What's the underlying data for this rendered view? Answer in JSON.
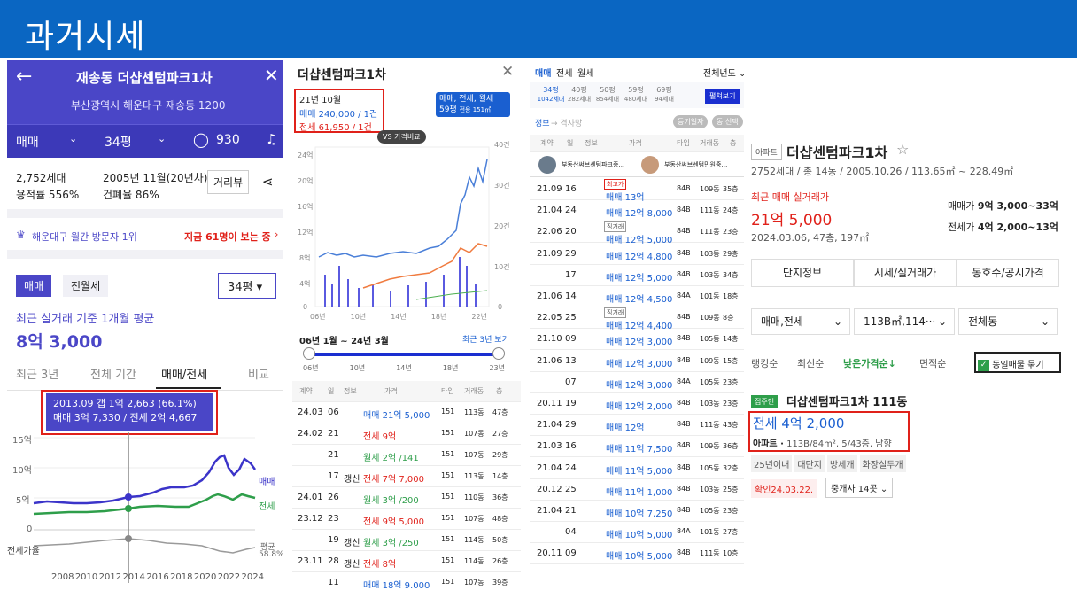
{
  "slide": {
    "title": "과거시세"
  },
  "p1": {
    "title": "재송동 더샵센텀파크1차",
    "address": "부산광역시 해운대구 재송동 1200",
    "tab_trade": "매매",
    "tab_size": "34평",
    "comment_count": "930",
    "households": "2,752세대",
    "built": "2005년 11월(20년차)",
    "far": "용적률 556%",
    "bcr": "건폐율 86%",
    "street_view": "거리뷰",
    "rank": "해운대구 월간 방문자 1위",
    "viewing": "지금 61명이 보는 중",
    "btn_trade": "매매",
    "btn_rent": "전월세",
    "size_select": "34평",
    "avg_label": "최근 실거래 기준 1개월 평균",
    "avg_price": "8억 3,000",
    "tabs": [
      "최근 3년",
      "전체 기간",
      "매매/전세",
      "비교"
    ],
    "tip1": "2013.09 갭 1억 2,663 (66.1%)",
    "tip2": "매매 3억 7,330 / 전세 2억 4,667",
    "y_labels": [
      "15억",
      "10억",
      "5억",
      "0"
    ],
    "legend_sale": "매매",
    "legend_rent": "전세",
    "ratio_label": "전세가율",
    "avg_text": "평균",
    "avg_ratio": "58.8%",
    "x_labels": [
      "2008",
      "2010",
      "2012",
      "2014",
      "2016",
      "2018",
      "2020",
      "2022",
      "2024"
    ]
  },
  "p2": {
    "title": "더샵센텀파크1차",
    "month": "21년 10월",
    "sale": "매매 240,000 / 1건",
    "rent": "전세 61,950 / 1건",
    "filter1": "매매, 전세, 월세",
    "filter2": "59평",
    "filter3": "전용 151㎡",
    "vs_label": "VS 가격비교",
    "y_left": [
      "24억",
      "20억",
      "16억",
      "12억",
      "8억",
      "4억",
      "0"
    ],
    "y_right": [
      "40건",
      "30건",
      "20건",
      "10건",
      "0"
    ],
    "x_labels": [
      "06년",
      "10년",
      "14년",
      "18년",
      "22년"
    ],
    "range": "06년 1월 ~ 24년 3월",
    "recent": "최근 3년 보기",
    "slider_ticks": [
      "06년",
      "10년",
      "14년",
      "18년",
      "23년"
    ],
    "headers": [
      "계약",
      "일",
      "정보",
      "가격",
      "타입",
      "거래동",
      "층"
    ],
    "rows": [
      {
        "m": "24.03",
        "d": "06",
        "info": "",
        "price": "매매 21억 5,000",
        "type": "151",
        "dong": "113동",
        "floor": "47층",
        "kind": "sale"
      },
      {
        "m": "24.02",
        "d": "21",
        "info": "",
        "price": "전세 9억",
        "type": "151",
        "dong": "107동",
        "floor": "27층",
        "kind": "rent"
      },
      {
        "m": "",
        "d": "21",
        "info": "",
        "price": "월세 2억 /141",
        "type": "151",
        "dong": "107동",
        "floor": "29층",
        "kind": "month"
      },
      {
        "m": "",
        "d": "17",
        "info": "갱신",
        "price": "전세 7억 7,000",
        "type": "151",
        "dong": "113동",
        "floor": "14층",
        "kind": "rent"
      },
      {
        "m": "24.01",
        "d": "26",
        "info": "",
        "price": "월세 3억 /200",
        "type": "151",
        "dong": "110동",
        "floor": "36층",
        "kind": "month"
      },
      {
        "m": "23.12",
        "d": "23",
        "info": "",
        "price": "전세 9억 5,000",
        "type": "151",
        "dong": "107동",
        "floor": "48층",
        "kind": "rent"
      },
      {
        "m": "",
        "d": "19",
        "info": "갱신",
        "price": "월세 3억 /250",
        "type": "151",
        "dong": "114동",
        "floor": "50층",
        "kind": "month"
      },
      {
        "m": "23.11",
        "d": "28",
        "info": "갱신",
        "price": "전세 8억",
        "type": "151",
        "dong": "114동",
        "floor": "26층",
        "kind": "rent"
      },
      {
        "m": "",
        "d": "11",
        "info": "",
        "price": "매매 18억 9,000",
        "type": "151",
        "dong": "107동",
        "floor": "39층",
        "kind": "sale"
      }
    ]
  },
  "p3": {
    "tabs": [
      "매매",
      "전세",
      "월세"
    ],
    "year": "전체년도",
    "sizes": [
      {
        "a": "34평",
        "b": "1042세대"
      },
      {
        "a": "40평",
        "b": "282세대"
      },
      {
        "a": "50평",
        "b": "854세대"
      },
      {
        "a": "59평",
        "b": "480세대"
      },
      {
        "a": "69평",
        "b": "94세대"
      }
    ],
    "fold": "펼쳐보기",
    "info": "정보",
    "grid": "격자망",
    "reg_date": "등기일자",
    "dong_select": "동 선택",
    "headers": [
      "계약",
      "일",
      "정보",
      "가격",
      "타입",
      "거래동",
      "층"
    ],
    "agents": [
      "부동산써브센텀파크중…",
      "부동산써브센텀민원중…"
    ],
    "rows": [
      {
        "m": "21.09",
        "d": "16",
        "tag": "최고가",
        "price": "매매 13억",
        "type": "84B",
        "dong": "109동",
        "floor": "35층"
      },
      {
        "m": "21.04",
        "d": "24",
        "tag": "",
        "price": "매매 12억 8,000",
        "type": "84B",
        "dong": "111동",
        "floor": "24층"
      },
      {
        "m": "22.06",
        "d": "20",
        "tag": "직거래",
        "price": "매매 12억 5,000",
        "type": "84B",
        "dong": "111동",
        "floor": "23층"
      },
      {
        "m": "21.09",
        "d": "29",
        "tag": "",
        "price": "매매 12억 4,800",
        "type": "84B",
        "dong": "103동",
        "floor": "29층"
      },
      {
        "m": "",
        "d": "17",
        "tag": "",
        "price": "매매 12억 5,000",
        "type": "84B",
        "dong": "103동",
        "floor": "34층"
      },
      {
        "m": "21.06",
        "d": "14",
        "tag": "",
        "price": "매매 12억 4,500",
        "type": "84A",
        "dong": "101동",
        "floor": "18층"
      },
      {
        "m": "22.05",
        "d": "25",
        "tag": "직거래",
        "price": "매매 12억 4,400",
        "type": "84B",
        "dong": "109동",
        "floor": "8층"
      },
      {
        "m": "21.10",
        "d": "09",
        "tag": "",
        "price": "매매 12억 3,000",
        "type": "84B",
        "dong": "105동",
        "floor": "14층"
      },
      {
        "m": "21.06",
        "d": "13",
        "tag": "",
        "price": "매매 12억 3,000",
        "type": "84B",
        "dong": "109동",
        "floor": "15층"
      },
      {
        "m": "",
        "d": "07",
        "tag": "",
        "price": "매매 12억 3,000",
        "type": "84A",
        "dong": "105동",
        "floor": "23층"
      },
      {
        "m": "20.11",
        "d": "19",
        "tag": "",
        "price": "매매 12억 2,000",
        "type": "84B",
        "dong": "103동",
        "floor": "23층"
      },
      {
        "m": "21.04",
        "d": "29",
        "tag": "",
        "price": "매매 12억",
        "type": "84B",
        "dong": "111동",
        "floor": "43층"
      },
      {
        "m": "21.03",
        "d": "16",
        "tag": "",
        "price": "매매 11억 7,500",
        "type": "84B",
        "dong": "109동",
        "floor": "36층"
      },
      {
        "m": "21.04",
        "d": "24",
        "tag": "",
        "price": "매매 11억 5,000",
        "type": "84B",
        "dong": "105동",
        "floor": "32층"
      },
      {
        "m": "20.12",
        "d": "25",
        "tag": "",
        "price": "매매 11억 1,000",
        "type": "84B",
        "dong": "103동",
        "floor": "25층"
      },
      {
        "m": "21.04",
        "d": "21",
        "tag": "",
        "price": "매매 10억 7,250",
        "type": "84B",
        "dong": "105동",
        "floor": "23층"
      },
      {
        "m": "",
        "d": "04",
        "tag": "",
        "price": "매매 10억 5,000",
        "type": "84A",
        "dong": "101동",
        "floor": "27층"
      },
      {
        "m": "20.11",
        "d": "09",
        "tag": "",
        "price": "매매 10억 5,000",
        "type": "84B",
        "dong": "111동",
        "floor": "10층"
      }
    ]
  },
  "p4": {
    "badge": "아파트",
    "name": "더샵센텀파크1차",
    "star": "☆",
    "desc": "2752세대 / 총 14동 / 2005.10.26 / 113.65㎡ ~ 228.49㎡",
    "recent_label": "최근 매매 실거래가",
    "recent_price": "21억 5,000",
    "recent_detail": "2024.03.06, 47층, 197㎡",
    "sale_label": "매매가",
    "sale_range": "9억 3,000~33억",
    "rent_label": "전세가",
    "rent_range": "4억 2,000~13억",
    "tabs": [
      "단지정보",
      "시세/실거래가",
      "동호수/공시가격"
    ],
    "select1": "매매,전세",
    "select2": "113B㎡,114···",
    "select3": "전체동",
    "sort": [
      "랭킹순",
      "최신순",
      "낮은가격순↓",
      "면적순"
    ],
    "same": "동일매물 묶기",
    "owner": "집주인",
    "listing": "더샵센텀파크1차 111동",
    "listing_price": "전세 4억 2,000",
    "listing_type": "아파트 ·",
    "listing_detail": "113B/84m², 5/43층, 남향",
    "tags": [
      "25년이내",
      "대단지",
      "방세개",
      "화장실두개"
    ],
    "confirm": "확인24.03.22.",
    "agent": "중개사 14곳"
  }
}
